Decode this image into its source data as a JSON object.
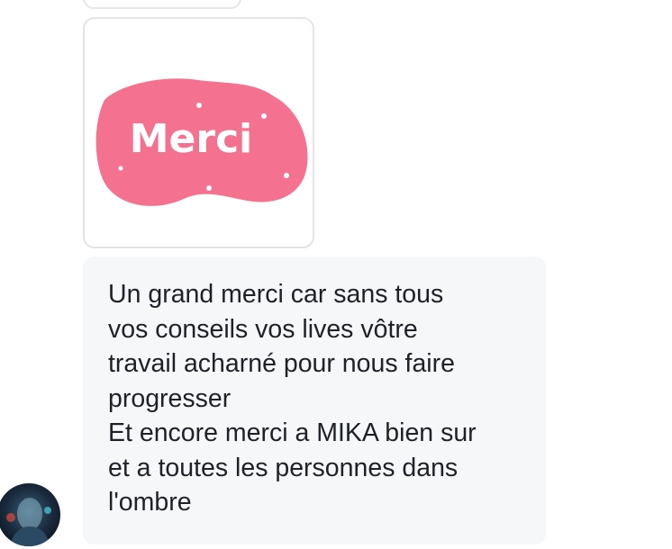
{
  "sticker": {
    "text": "Merci",
    "accent_color": "#f4728f"
  },
  "message": {
    "lines": [
      "Un grand merci car sans tous",
      "vos conseils vos lives vôtre",
      "travail acharné pour nous faire",
      "progresser",
      "Et encore merci a MIKA bien sur",
      "et a toutes les personnes dans",
      "l'ombre"
    ]
  },
  "avatar": {
    "icon": "user-avatar"
  }
}
